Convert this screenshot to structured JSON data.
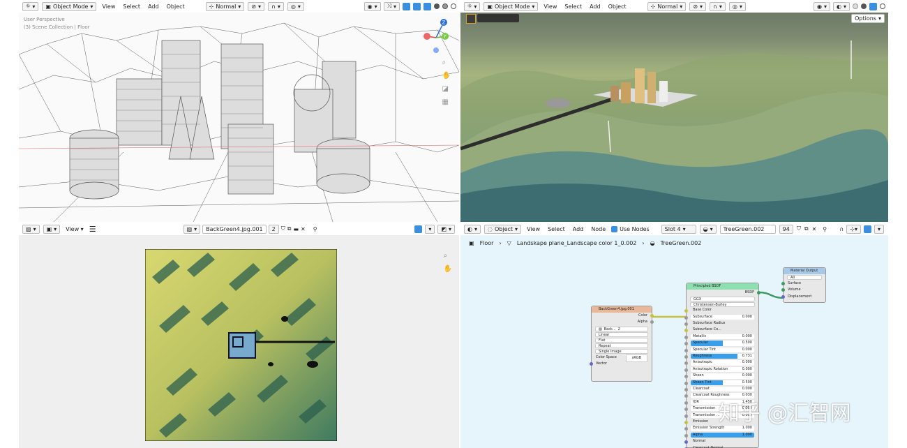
{
  "viewport3d_left": {
    "mode": "Object Mode",
    "menus": [
      "View",
      "Select",
      "Add",
      "Object"
    ],
    "orientation": "Normal",
    "overlay_title": "User Perspective",
    "overlay_collection": "(3) Scene Collection | Floor",
    "gizmo": {
      "z": "Z",
      "y": "Y"
    }
  },
  "viewport3d_right": {
    "mode": "Object Mode",
    "menus": [
      "View",
      "Select",
      "Add",
      "Object"
    ],
    "orientation": "Normal",
    "options_label": "Options"
  },
  "image_editor": {
    "view_menu": "View",
    "image_name": "BackGreen4.jpg.001",
    "users": "2"
  },
  "node_editor": {
    "editor_type": "Object",
    "menus": [
      "View",
      "Select",
      "Add",
      "Node"
    ],
    "use_nodes_label": "Use Nodes",
    "slot": "Slot 4",
    "material_name": "TreeGreen.002",
    "material_users": "94",
    "breadcrumb": [
      "Floor",
      "Landskape plane_Landscape color 1_0.002",
      "TreeGreen.002"
    ]
  },
  "nodes": {
    "image_texture": {
      "title": "BackGreen4.jpg.001",
      "outputs": [
        "Color",
        "Alpha"
      ],
      "image_name": "Back...",
      "users": "2",
      "interpolation": "Linear",
      "projection": "Flat",
      "extension": "Repeat",
      "source": "Single Image",
      "color_space_label": "Color Space",
      "color_space": "sRGB",
      "vector_label": "Vector"
    },
    "principled": {
      "title": "Principled BSDF",
      "output": "BSDF",
      "distribution": "GGX",
      "subsurface_method": "Christensen-Burley",
      "params": [
        {
          "name": "Base Color",
          "value": ""
        },
        {
          "name": "Subsurface",
          "value": "0.000"
        },
        {
          "name": "Subsurface Radius",
          "value": ""
        },
        {
          "name": "Subsurface Co...",
          "value": ""
        },
        {
          "name": "Metallic",
          "value": "0.000"
        },
        {
          "name": "Specular",
          "value": "0.500"
        },
        {
          "name": "Specular Tint",
          "value": "0.000"
        },
        {
          "name": "Roughness",
          "value": "0.731"
        },
        {
          "name": "Anisotropic",
          "value": "0.000"
        },
        {
          "name": "Anisotropic Rotation",
          "value": "0.000"
        },
        {
          "name": "Sheen",
          "value": "0.000"
        },
        {
          "name": "Sheen Tint",
          "value": "0.500"
        },
        {
          "name": "Clearcoat",
          "value": "0.000"
        },
        {
          "name": "Clearcoat Roughness",
          "value": "0.030"
        },
        {
          "name": "IOR",
          "value": "1.450"
        },
        {
          "name": "Transmission",
          "value": "0.000"
        },
        {
          "name": "Transmission ...",
          "value": "0.000"
        },
        {
          "name": "Emission",
          "value": ""
        },
        {
          "name": "Emission Strength",
          "value": "1.000"
        },
        {
          "name": "Alpha",
          "value": "1.000"
        },
        {
          "name": "Normal",
          "value": ""
        },
        {
          "name": "Clearcoat Normal",
          "value": ""
        }
      ]
    },
    "material_output": {
      "title": "Material Output",
      "target": "All",
      "inputs": [
        "Surface",
        "Volume",
        "Displacement"
      ]
    }
  },
  "watermark": "知乎 @汇智网"
}
